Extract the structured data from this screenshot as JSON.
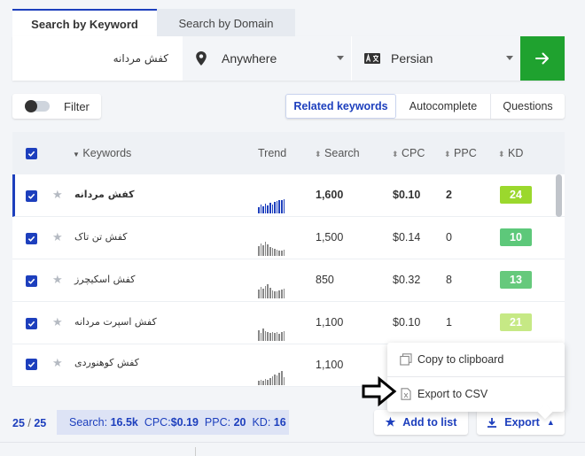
{
  "tabs": {
    "keyword": "Search by Keyword",
    "domain": "Search by Domain"
  },
  "search": {
    "keyword_value": "کفش مردانه",
    "location": "Anywhere",
    "language": "Persian"
  },
  "filter": {
    "label": "Filter"
  },
  "segments": [
    "Related keywords",
    "Autocomplete",
    "Questions"
  ],
  "table": {
    "headers": {
      "keywords": "Keywords",
      "trend": "Trend",
      "search": "Search",
      "cpc": "CPC",
      "ppc": "PPC",
      "kd": "KD"
    },
    "rows": [
      {
        "keyword": "کفش مردانه",
        "search": "1,600",
        "cpc": "$0.10",
        "ppc": "2",
        "kd": "24",
        "kd_color": "#9bd82d",
        "selected": true
      },
      {
        "keyword": "کفش تن تاک",
        "search": "1,500",
        "cpc": "$0.14",
        "ppc": "0",
        "kd": "10",
        "kd_color": "#5dc87a"
      },
      {
        "keyword": "کفش اسکیچرز",
        "search": "850",
        "cpc": "$0.32",
        "ppc": "8",
        "kd": "13",
        "kd_color": "#66c97c"
      },
      {
        "keyword": "کفش اسپرت مردانه",
        "search": "1,100",
        "cpc": "$0.10",
        "ppc": "1",
        "kd": "21",
        "kd_color": "#c6e985"
      },
      {
        "keyword": "کفش کوهنوردی",
        "search": "1,100",
        "cpc": "",
        "ppc": "",
        "kd": "",
        "kd_color": ""
      }
    ]
  },
  "footer": {
    "count_shown": "25",
    "count_total": "25",
    "stats": {
      "search_label": "Search:",
      "search": "16.5k",
      "cpc_label": "CPC:",
      "cpc": "$0.19",
      "ppc_label": "PPC:",
      "ppc": "20",
      "kd_label": "KD:",
      "kd": "16"
    },
    "add_to_list": "Add to list",
    "export": "Export"
  },
  "export_menu": {
    "copy": "Copy to clipboard",
    "csv": "Export to CSV"
  },
  "colors": {
    "accent": "#1d3fbd",
    "go_button": "#1fa22f"
  }
}
